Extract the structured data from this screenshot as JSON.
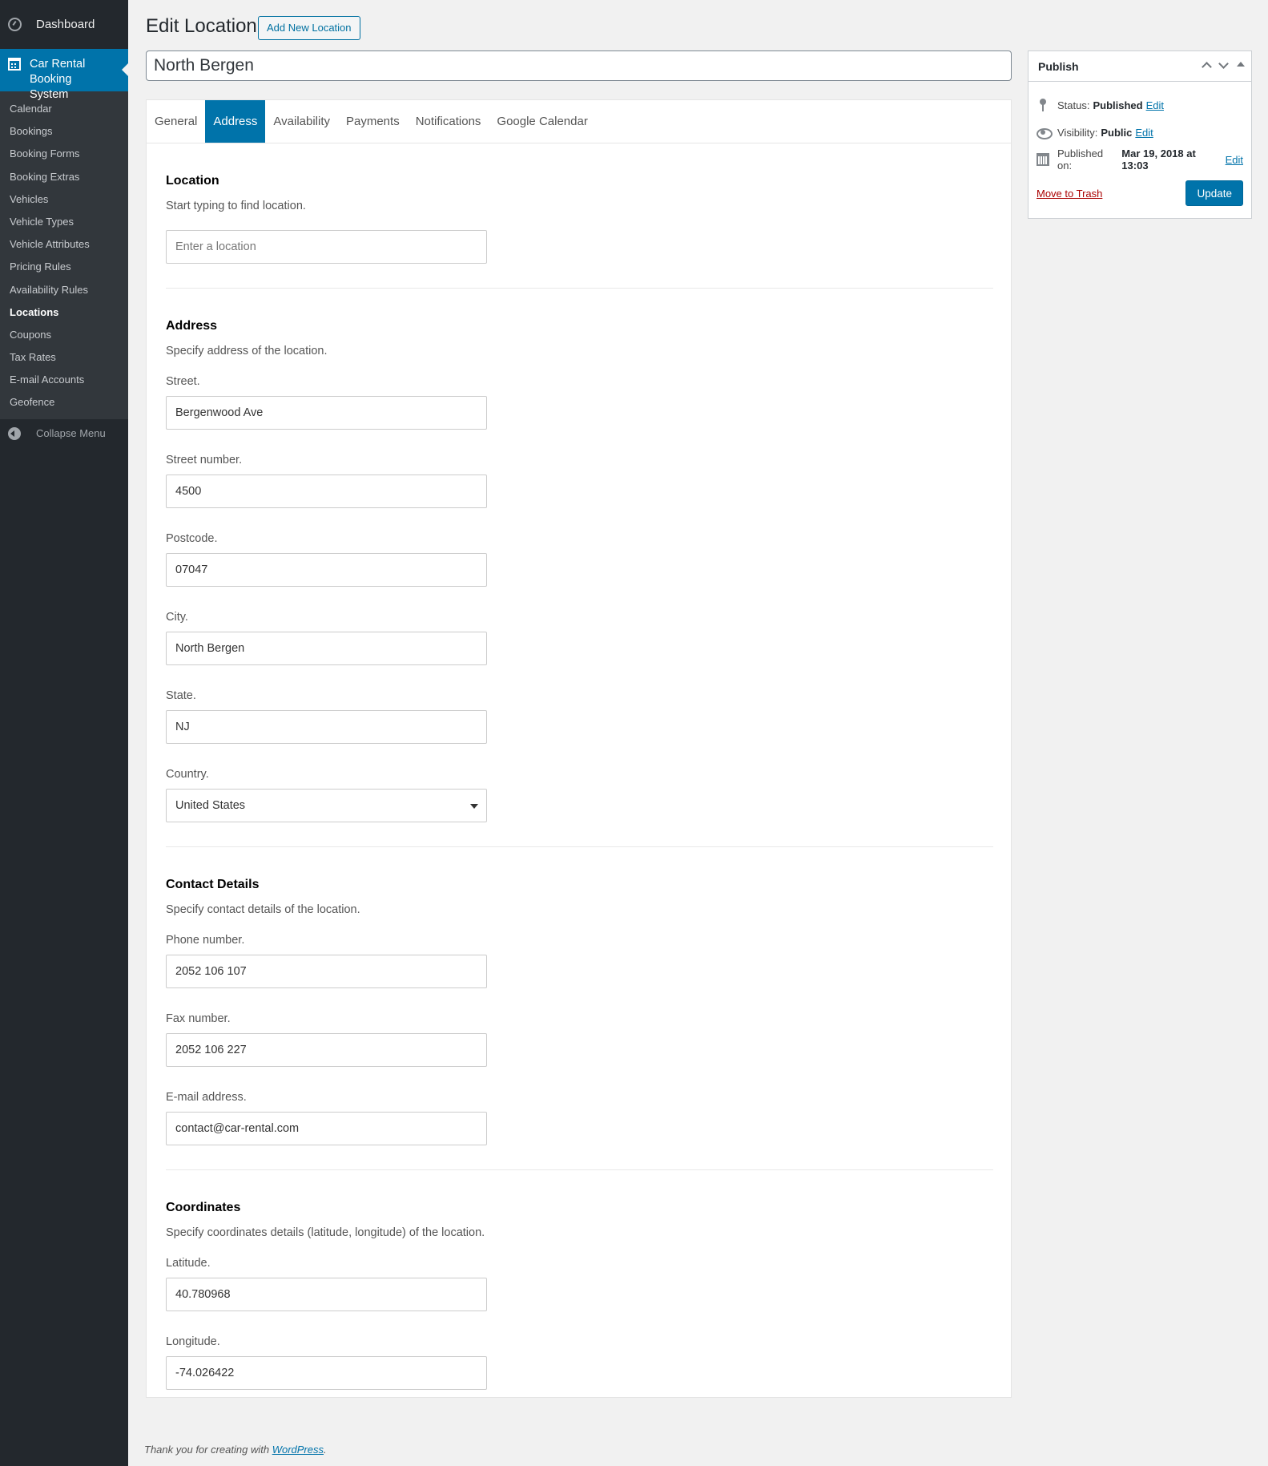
{
  "sidebar": {
    "dashboard_label": "Dashboard",
    "active_menu_label": "Car Rental Booking System",
    "items": [
      {
        "label": "Calendar"
      },
      {
        "label": "Bookings"
      },
      {
        "label": "Booking Forms"
      },
      {
        "label": "Booking Extras"
      },
      {
        "label": "Vehicles"
      },
      {
        "label": "Vehicle Types"
      },
      {
        "label": "Vehicle Attributes"
      },
      {
        "label": "Pricing Rules"
      },
      {
        "label": "Availability Rules"
      },
      {
        "label": "Locations"
      },
      {
        "label": "Coupons"
      },
      {
        "label": "Tax Rates"
      },
      {
        "label": "E-mail Accounts"
      },
      {
        "label": "Geofence"
      }
    ],
    "current_item": "Locations",
    "collapse_label": "Collapse Menu"
  },
  "header": {
    "title": "Edit Location",
    "add_new_label": "Add New Location",
    "post_title": "North Bergen"
  },
  "tabs": [
    "General",
    "Address",
    "Availability",
    "Payments",
    "Notifications",
    "Google Calendar"
  ],
  "active_tab": "Address",
  "location_section": {
    "title": "Location",
    "description": "Start typing to find location.",
    "placeholder": "Enter a location"
  },
  "address_section": {
    "title": "Address",
    "description": "Specify address of the location.",
    "street_label": "Street.",
    "street_value": "Bergenwood Ave",
    "street_number_label": "Street number.",
    "street_number_value": "4500",
    "postcode_label": "Postcode.",
    "postcode_value": "07047",
    "city_label": "City.",
    "city_value": "North Bergen",
    "state_label": "State.",
    "state_value": "NJ",
    "country_label": "Country.",
    "country_value": "United States"
  },
  "contact_section": {
    "title": "Contact Details",
    "description": "Specify contact details of the location.",
    "phone_label": "Phone number.",
    "phone_value": "2052 106 107",
    "fax_label": "Fax number.",
    "fax_value": "2052 106 227",
    "email_label": "E-mail address.",
    "email_value": "contact@car-rental.com"
  },
  "coordinates_section": {
    "title": "Coordinates",
    "description": "Specify coordinates details (latitude, longitude) of the location.",
    "latitude_label": "Latitude.",
    "latitude_value": "40.780968",
    "longitude_label": "Longitude.",
    "longitude_value": "-74.026422"
  },
  "publish": {
    "title": "Publish",
    "status_label": "Status:",
    "status_value": "Published",
    "visibility_label": "Visibility:",
    "visibility_value": "Public",
    "published_on_label": "Published on:",
    "published_on_value": "Mar 19, 2018 at 13:03",
    "edit_label": "Edit",
    "trash_label": "Move to Trash",
    "update_label": "Update"
  },
  "footer": {
    "text": "Thank you for creating with",
    "link": "WordPress",
    "end": "."
  },
  "colors": {
    "accent": "#0073aa",
    "sidebar_bg": "#23282d",
    "trash": "#aa0000"
  }
}
